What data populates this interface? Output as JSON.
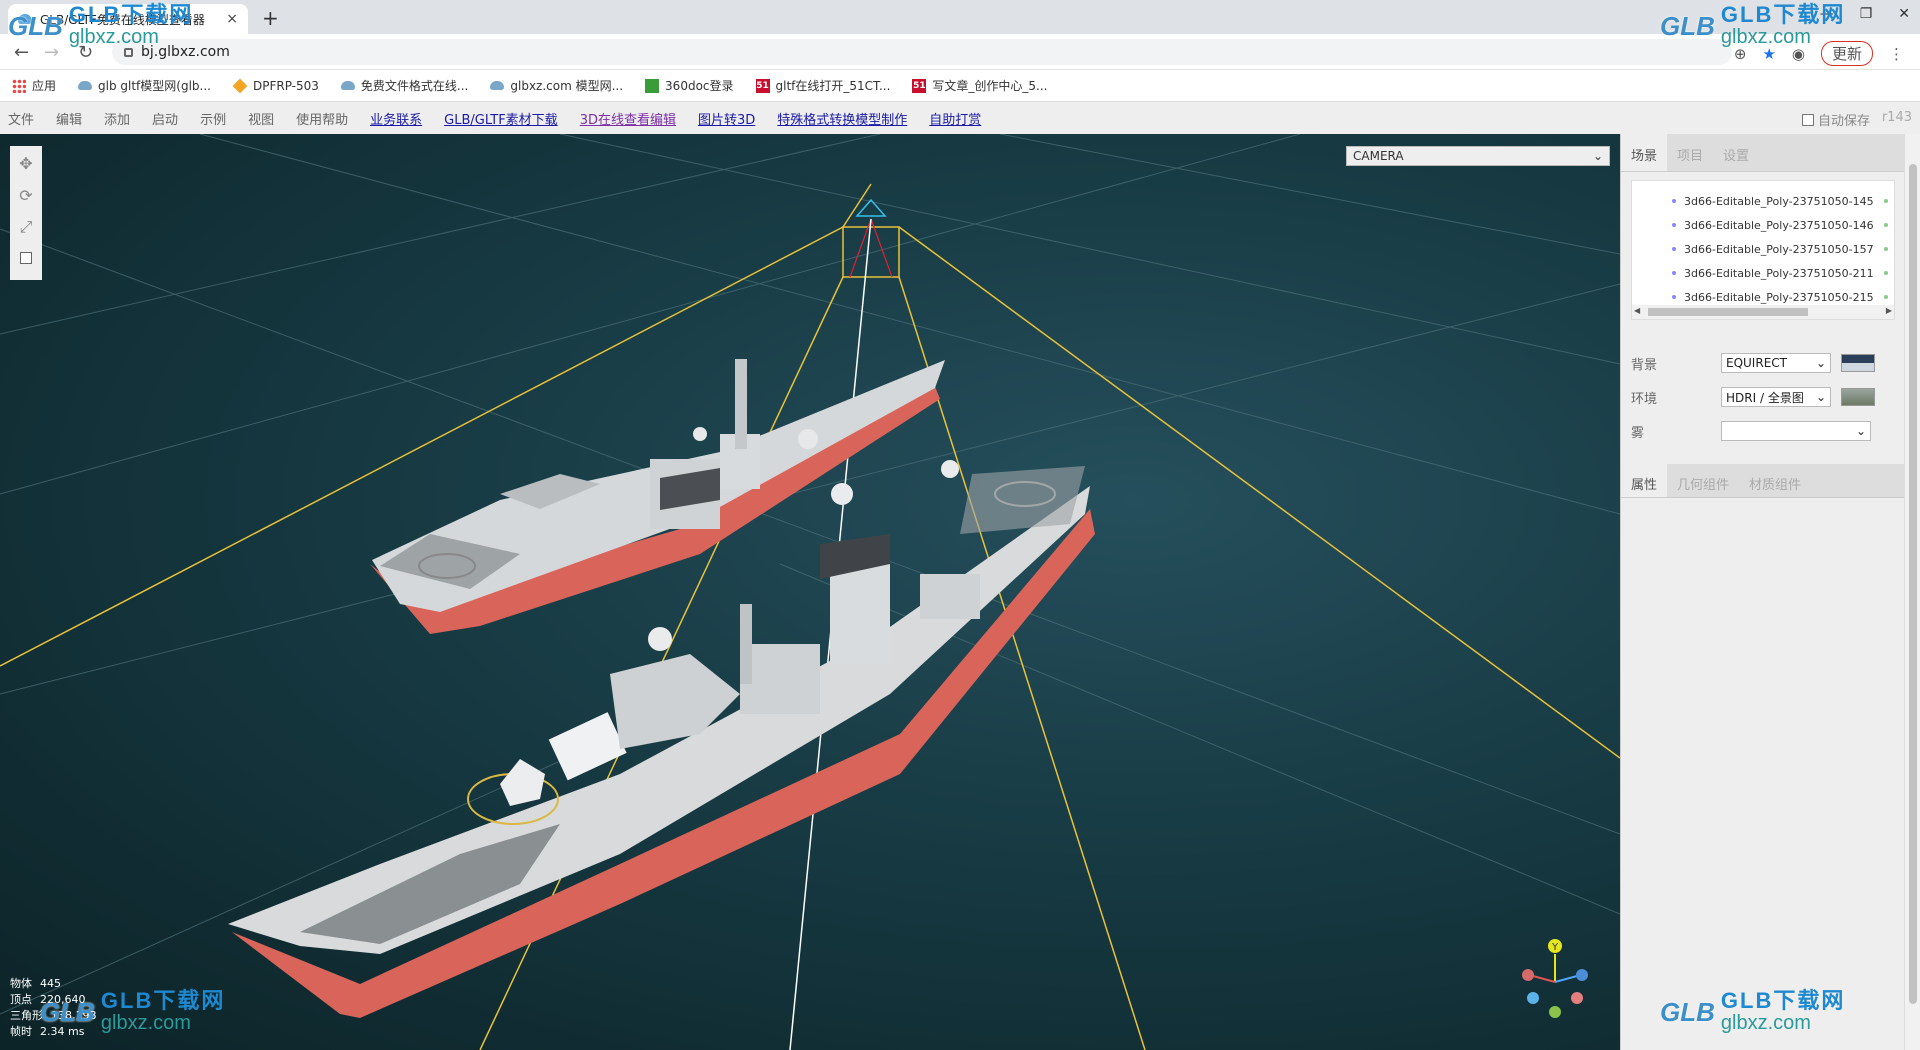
{
  "browser": {
    "tab_title": "GLB/GLTF免费在线模型查看器",
    "url": "bj.glbxz.com",
    "update_label": "更新"
  },
  "bookmarks": [
    {
      "label": "应用",
      "icon": "apps-grid-icon"
    },
    {
      "label": "glb gltf模型网(glb...",
      "icon": "cloud-icon"
    },
    {
      "label": "DPFRP-503",
      "icon": "diamond-icon"
    },
    {
      "label": "免费文件格式在线...",
      "icon": "cloud-icon"
    },
    {
      "label": "glbxz.com 模型网...",
      "icon": "cloud-icon"
    },
    {
      "label": "360doc登录",
      "icon": "360doc-icon"
    },
    {
      "label": "gltf在线打开_51CT...",
      "icon": "51cto-icon"
    },
    {
      "label": "写文章_创作中心_5...",
      "icon": "51cto-icon"
    }
  ],
  "menu": {
    "items": [
      "文件",
      "编辑",
      "添加",
      "启动",
      "示例",
      "视图",
      "使用帮助"
    ],
    "links": [
      "业务联系",
      "GLB/GLTF素材下载",
      "3D在线查看编辑",
      "图片转3D",
      "特殊格式转换模型制作",
      "自助打赏"
    ],
    "autosave_label": "自动保存",
    "version": "r143"
  },
  "viewport": {
    "camera_select": "CAMERA",
    "stats": {
      "objects_label": "物体",
      "objects": "445",
      "vertices_label": "顶点",
      "vertices": "220,640",
      "triangles_label": "三角形",
      "triangles": "138,198",
      "frame_label": "帧时",
      "frame": "2.34 ms"
    },
    "axis_labels": {
      "y": "Y"
    }
  },
  "sidebar": {
    "tabs": [
      "场景",
      "项目",
      "设置"
    ],
    "outliner": [
      "3d66-Editable_Poly-23751050-145",
      "3d66-Editable_Poly-23751050-146",
      "3d66-Editable_Poly-23751050-157",
      "3d66-Editable_Poly-23751050-211",
      "3d66-Editable_Poly-23751050-215"
    ],
    "background_label": "背景",
    "background_value": "EQUIRECT",
    "environment_label": "环境",
    "environment_value": "HDRI / 全景图",
    "fog_label": "雾",
    "fog_value": "",
    "prop_tabs": [
      "属性",
      "几何组件",
      "材质组件"
    ]
  },
  "watermark": {
    "brand": "GLB",
    "cn": "GLB下载网",
    "domain": "glbxz.com"
  },
  "colors": {
    "frustum": "#e8c23a",
    "hull_red": "#d9645a",
    "ship_grey": "#d8dadb",
    "link": "#1a1aa6"
  }
}
